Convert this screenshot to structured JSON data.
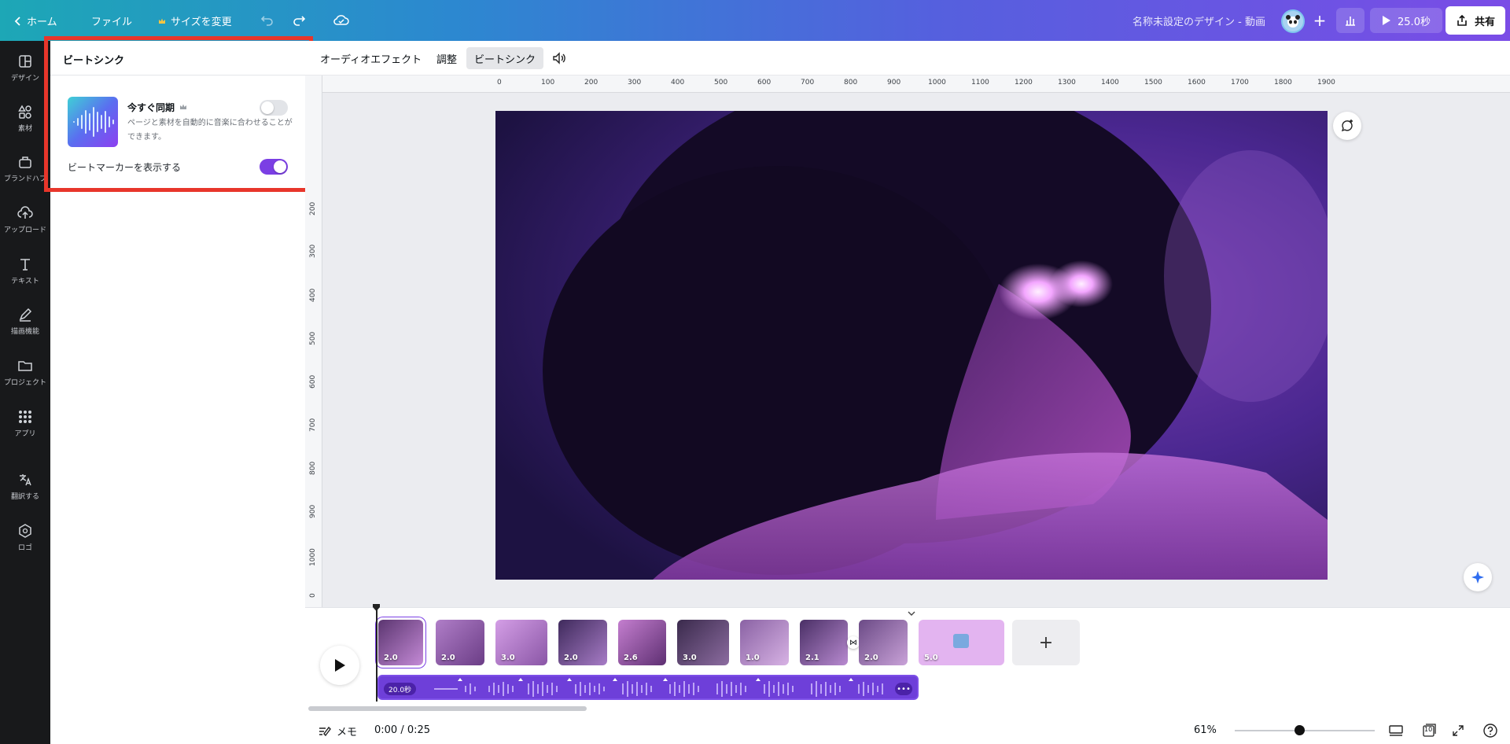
{
  "topbar": {
    "home_label": "ホーム",
    "file_label": "ファイル",
    "resize_label": "サイズを変更",
    "doc_title": "名称未設定のデザイン - 動画",
    "play_label": "25.0秒",
    "share_label": "共有"
  },
  "rail": {
    "items": [
      {
        "label": "デザイン",
        "icon": "layout-icon"
      },
      {
        "label": "素材",
        "icon": "shapes-icon"
      },
      {
        "label": "ブランドハブ",
        "icon": "brand-icon"
      },
      {
        "label": "アップロード",
        "icon": "upload-icon"
      },
      {
        "label": "テキスト",
        "icon": "text-icon"
      },
      {
        "label": "描画機能",
        "icon": "draw-icon"
      },
      {
        "label": "プロジェクト",
        "icon": "folder-icon"
      },
      {
        "label": "アプリ",
        "icon": "apps-icon"
      },
      {
        "label": "翻訳する",
        "icon": "translate-icon"
      },
      {
        "label": "ロゴ",
        "icon": "logo-icon"
      }
    ]
  },
  "panel": {
    "title": "ビートシンク",
    "sync_title": "今すぐ同期",
    "sync_desc": "ページと素材を自動的に音楽に合わせることができます。",
    "sync_enabled": false,
    "marker_label": "ビートマーカーを表示する",
    "marker_enabled": true
  },
  "toolbar": {
    "audio_effects": "オーディオエフェクト",
    "adjust": "調整",
    "beat_sync": "ビートシンク"
  },
  "rulers": {
    "top": [
      "0",
      "100",
      "200",
      "300",
      "400",
      "500",
      "600",
      "700",
      "800",
      "900",
      "1000",
      "1100",
      "1200",
      "1300",
      "1400",
      "1500",
      "1600",
      "1700",
      "1800",
      "1900"
    ],
    "left": [
      "200",
      "300",
      "400",
      "500",
      "600",
      "700",
      "800",
      "900",
      "1000",
      "0"
    ]
  },
  "timeline": {
    "clips": [
      "2.0",
      "2.0",
      "3.0",
      "2.0",
      "2.6",
      "3.0",
      "1.0",
      "2.1",
      "2.0",
      "5.0"
    ],
    "audio_length": "20.0秒",
    "audio_more": "•••"
  },
  "bottom": {
    "memo_label": "メモ",
    "time": "0:00 / 0:25",
    "zoom": "61%",
    "page_count": "10"
  },
  "colors": {
    "accent": "#7b3fe4",
    "highlight": "#e8362b"
  }
}
